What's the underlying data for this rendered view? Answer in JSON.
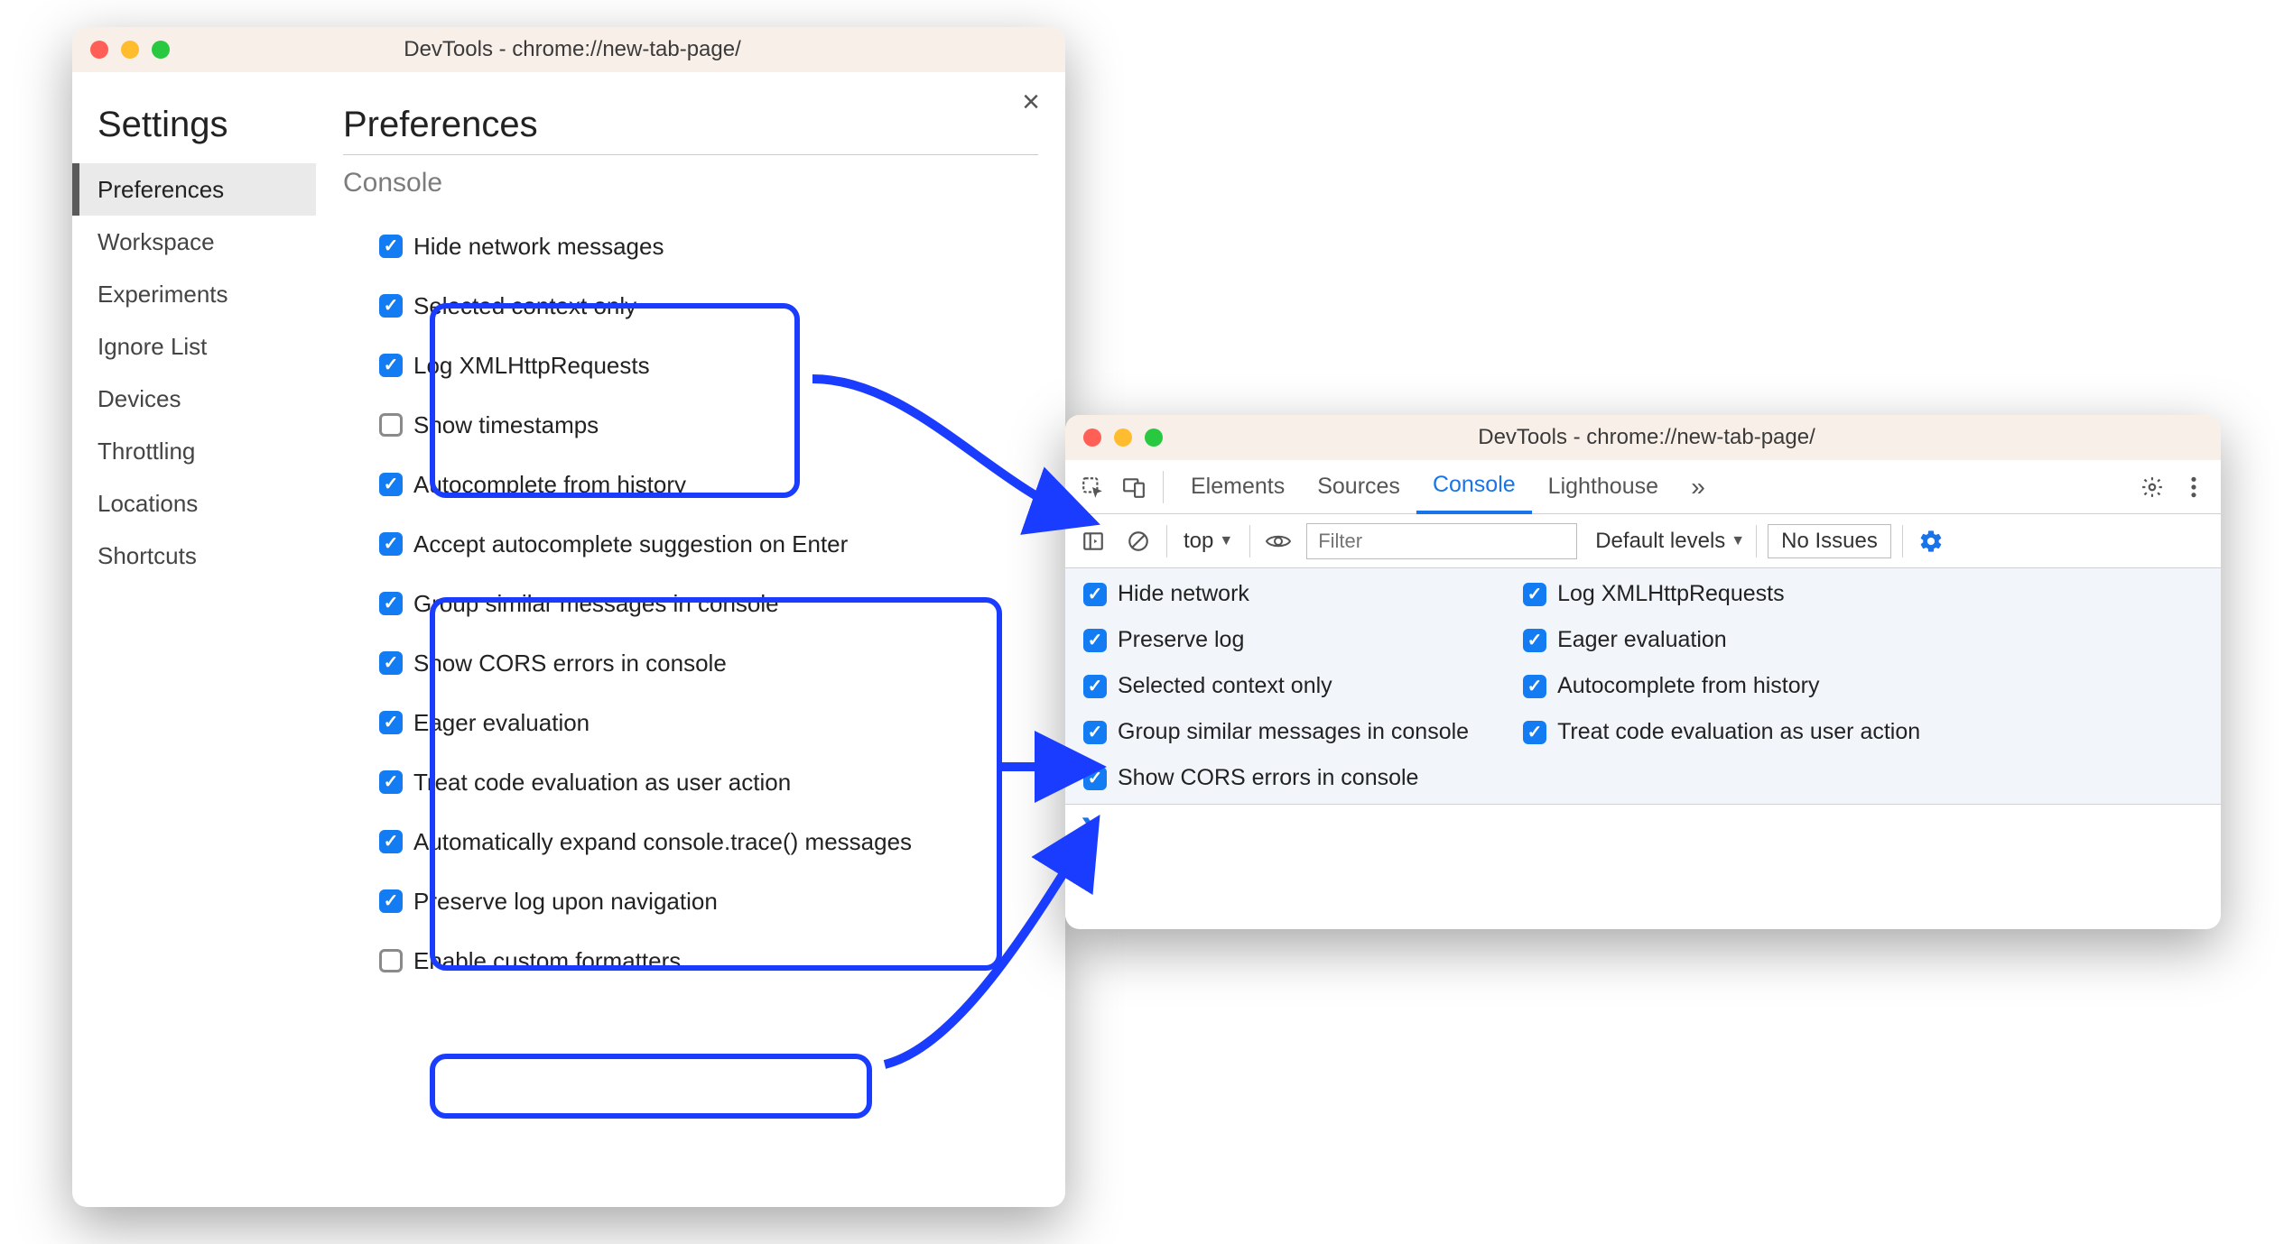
{
  "settings": {
    "window_title": "DevTools - chrome://new-tab-page/",
    "heading": "Settings",
    "main_heading": "Preferences",
    "section": "Console",
    "sidebar_items": [
      {
        "label": "Preferences",
        "selected": true
      },
      {
        "label": "Workspace",
        "selected": false
      },
      {
        "label": "Experiments",
        "selected": false
      },
      {
        "label": "Ignore List",
        "selected": false
      },
      {
        "label": "Devices",
        "selected": false
      },
      {
        "label": "Throttling",
        "selected": false
      },
      {
        "label": "Locations",
        "selected": false
      },
      {
        "label": "Shortcuts",
        "selected": false
      }
    ],
    "options": [
      {
        "label": "Hide network messages",
        "checked": true
      },
      {
        "label": "Selected context only",
        "checked": true
      },
      {
        "label": "Log XMLHttpRequests",
        "checked": true
      },
      {
        "label": "Show timestamps",
        "checked": false
      },
      {
        "label": "Autocomplete from history",
        "checked": true
      },
      {
        "label": "Accept autocomplete suggestion on Enter",
        "checked": true
      },
      {
        "label": "Group similar messages in console",
        "checked": true
      },
      {
        "label": "Show CORS errors in console",
        "checked": true
      },
      {
        "label": "Eager evaluation",
        "checked": true
      },
      {
        "label": "Treat code evaluation as user action",
        "checked": true
      },
      {
        "label": "Automatically expand console.trace() messages",
        "checked": true
      },
      {
        "label": "Preserve log upon navigation",
        "checked": true
      },
      {
        "label": "Enable custom formatters",
        "checked": false
      }
    ]
  },
  "console": {
    "window_title": "DevTools - chrome://new-tab-page/",
    "tabs": [
      "Elements",
      "Sources",
      "Console",
      "Lighthouse"
    ],
    "active_tab": "Console",
    "context_label": "top",
    "filter_placeholder": "Filter",
    "levels_label": "Default levels",
    "issues_label": "No Issues",
    "settings_left": [
      {
        "label": "Hide network",
        "checked": true
      },
      {
        "label": "Preserve log",
        "checked": true
      },
      {
        "label": "Selected context only",
        "checked": true
      },
      {
        "label": "Group similar messages in console",
        "checked": true
      },
      {
        "label": "Show CORS errors in console",
        "checked": true
      }
    ],
    "settings_right": [
      {
        "label": "Log XMLHttpRequests",
        "checked": true
      },
      {
        "label": "Eager evaluation",
        "checked": true
      },
      {
        "label": "Autocomplete from history",
        "checked": true
      },
      {
        "label": "Treat code evaluation as user action",
        "checked": true
      }
    ]
  },
  "colors": {
    "highlight": "#1a3cff",
    "accent": "#1a73e8",
    "checkbox": "#137cf3"
  }
}
